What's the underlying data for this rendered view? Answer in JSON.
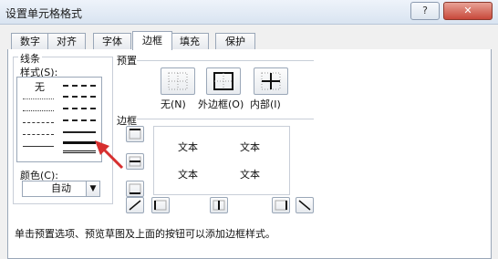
{
  "window": {
    "title": "设置单元格格式",
    "help_label": "?",
    "close_label": "✕"
  },
  "tabs": [
    {
      "label": "数字"
    },
    {
      "label": "对齐"
    },
    {
      "label": "字体"
    },
    {
      "label": "边框",
      "active": true
    },
    {
      "label": "填充"
    },
    {
      "label": "保护"
    }
  ],
  "line": {
    "group_label": "线条",
    "style_label": "样式(S):",
    "none_label": "无",
    "color_label": "颜色(C):",
    "color_value": "自动"
  },
  "presets": {
    "group_label": "预置",
    "items": [
      {
        "label": "无(N)",
        "icon": "border-none-icon"
      },
      {
        "label": "外边框(O)",
        "icon": "border-outline-icon"
      },
      {
        "label": "内部(I)",
        "icon": "border-inside-icon"
      }
    ]
  },
  "border": {
    "group_label": "边框",
    "preview_texts": [
      "文本",
      "文本",
      "文本",
      "文本"
    ]
  },
  "hint": "单击预置选项、预览草图及上面的按钮可以添加边框样式。",
  "colors": {
    "annotation_arrow": "#d62f2f",
    "active_tab": "#ffffff"
  }
}
